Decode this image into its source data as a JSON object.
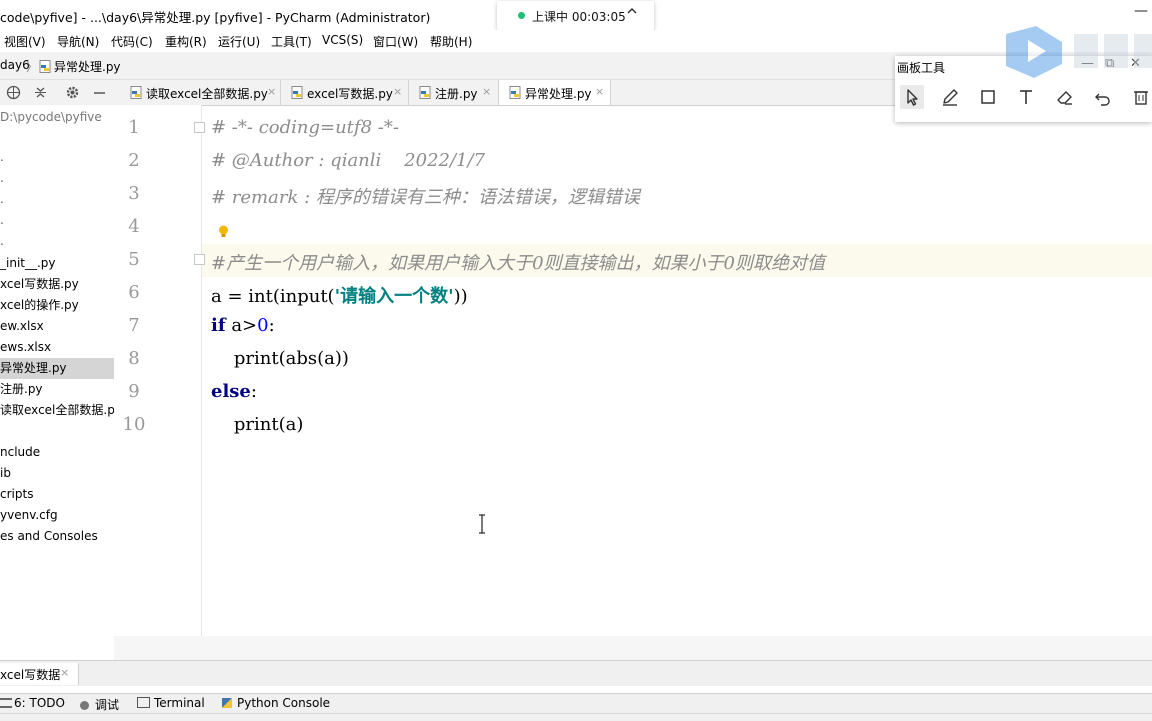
{
  "window": {
    "title": "code\\pyfive] - ...\\day6\\异常处理.py [pyfive] - PyCharm (Administrator)",
    "minimize_glyph": "—"
  },
  "live_class": {
    "text": "上课中 00:03:05",
    "status_color": "#1ec074"
  },
  "menu": {
    "items": [
      "视图(V)",
      "导航(N)",
      "代码(C)",
      "重构(R)",
      "运行(U)",
      "工具(T)",
      "VCS(S)",
      "窗口(W)",
      "帮助(H)"
    ]
  },
  "breadcrumb": {
    "folder": "day6",
    "separator": "〉",
    "file": "异常处理.py"
  },
  "project_tools": {
    "icons": [
      "globe-icon",
      "collapse-icon",
      "gear-icon",
      "hide-icon"
    ]
  },
  "tabs": [
    {
      "label": "读取excel全部数据.py",
      "close": "×"
    },
    {
      "label": "excel写数据.py",
      "close": "×"
    },
    {
      "label": "注册.py",
      "close": "×"
    },
    {
      "label": "异常处理.py",
      "close": "×",
      "active": true
    }
  ],
  "project_tree": {
    "root_path": "D:\\pycode\\pyfive",
    "items": [
      ".",
      ".",
      ".",
      ".",
      ".",
      "_init__.py",
      "xcel写数据.py",
      "xcel的操作.py",
      "ew.xlsx",
      "ews.xlsx",
      "异常处理.py",
      "注册.py",
      "读取excel全部数据.py",
      "",
      "nclude",
      "ib",
      "cripts",
      "yvenv.cfg",
      "es and Consoles"
    ],
    "selected_index": 10
  },
  "editor": {
    "line_numbers": [
      "1",
      "2",
      "3",
      "4",
      "5",
      "6",
      "7",
      "8",
      "9",
      "10"
    ],
    "lines": {
      "l1": "# -*- coding=utf8 -*-",
      "l2": "# @Author : qianli    2022/1/7",
      "l3": "# remark : 程序的错误有三种：语法错误，逻辑错误",
      "l5": "#产生一个用户输入，如果用户输入大于0则直接输出，如果小于0则取绝对值",
      "l6_a": "a = int(input(",
      "l6_str": "'请输入一个数'",
      "l6_b": "))",
      "l7_kw": "if",
      "l7_a": " a>",
      "l7_num": "0",
      "l7_b": ":",
      "l8": "    print(abs(a))",
      "l9_kw": "else",
      "l9_b": ":",
      "l10": "    print(a)"
    },
    "current_line": 5,
    "colors": {
      "comment": "#8c8c8c",
      "keyword": "#000080",
      "string": "#008080",
      "number": "#0000ff",
      "current_line": "#fcfaed"
    }
  },
  "run_panel": {
    "tab_label": "xcel写数据",
    "close": "×"
  },
  "bottom_toolbar": {
    "items": [
      {
        "icon": "list-icon",
        "label": "6: TODO"
      },
      {
        "icon": "bug-icon",
        "label": "调试"
      },
      {
        "icon": "terminal-icon",
        "label": "Terminal"
      },
      {
        "icon": "python-icon",
        "label": "Python Console"
      }
    ]
  },
  "draw_panel": {
    "title": "画板工具",
    "window_controls": [
      "—",
      "⧉",
      "✕"
    ],
    "tools": [
      "pointer-icon",
      "pen-icon",
      "rectangle-icon",
      "text-icon",
      "eraser-icon",
      "undo-icon",
      "trash-icon"
    ],
    "active_tool": 0
  }
}
